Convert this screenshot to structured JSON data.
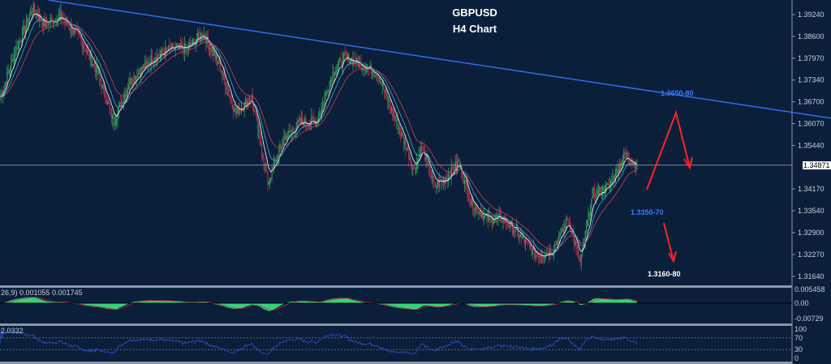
{
  "chart_data": {
    "type": "candlestick",
    "title": "GBPUSD",
    "subtitle": "H4 Chart",
    "ylim": [
      1.314,
      1.395
    ],
    "y_ticks": [
      "1.39240",
      "1.38600",
      "1.37970",
      "1.37340",
      "1.36700",
      "1.36070",
      "1.35440",
      "1.34870",
      "1.34170",
      "1.33540",
      "1.32900",
      "1.32270",
      "1.31640"
    ],
    "current_price": "1.34871",
    "price_path": [
      [
        0,
        1.3684
      ],
      [
        4,
        1.3825
      ],
      [
        8,
        1.3943
      ],
      [
        11,
        1.3896
      ],
      [
        15,
        1.3919
      ],
      [
        20,
        1.3849
      ],
      [
        24,
        1.3755
      ],
      [
        28,
        1.3613
      ],
      [
        32,
        1.3731
      ],
      [
        38,
        1.3802
      ],
      [
        42,
        1.3825
      ],
      [
        46,
        1.3825
      ],
      [
        50,
        1.3872
      ],
      [
        54,
        1.3778
      ],
      [
        58,
        1.3637
      ],
      [
        62,
        1.3684
      ],
      [
        66,
        1.3437
      ],
      [
        70,
        1.3566
      ],
      [
        74,
        1.3613
      ],
      [
        78,
        1.3613
      ],
      [
        82,
        1.3755
      ],
      [
        85,
        1.3802
      ],
      [
        89,
        1.3778
      ],
      [
        93,
        1.3755
      ],
      [
        96,
        1.366
      ],
      [
        100,
        1.3543
      ],
      [
        102,
        1.3472
      ],
      [
        104,
        1.3543
      ],
      [
        107,
        1.3425
      ],
      [
        110,
        1.3449
      ],
      [
        113,
        1.3496
      ],
      [
        116,
        1.3378
      ],
      [
        120,
        1.3331
      ],
      [
        124,
        1.3331
      ],
      [
        128,
        1.3284
      ],
      [
        132,
        1.3225
      ],
      [
        136,
        1.3237
      ],
      [
        140,
        1.3331
      ],
      [
        143,
        1.3202
      ],
      [
        146,
        1.3402
      ],
      [
        150,
        1.3425
      ],
      [
        154,
        1.3519
      ],
      [
        157,
        1.3487
      ]
    ],
    "trendline": {
      "from": [
        12,
        1.3966
      ],
      "to": [
        205,
        1.3623
      ],
      "label": "1.3650-80"
    },
    "support": {
      "price": 1.3369,
      "from": 139,
      "to": 174,
      "label": "1.3350-70"
    },
    "target_label": "1.3160-80",
    "macd": {
      "label": "26,9) 0.001055 0.001745",
      "ticks": [
        "0.005458",
        "0.00",
        "-0.00729"
      ]
    },
    "rsi": {
      "label": "2.0332",
      "ticks": [
        "100",
        "70",
        "30",
        "0"
      ]
    },
    "colors": {
      "bg": "#0b1f3a",
      "up": "#2e9e5e",
      "down": "#b0304a",
      "trend": "#2f6cf0",
      "arrow": "#ff2222",
      "macd": "#35d27a"
    }
  }
}
